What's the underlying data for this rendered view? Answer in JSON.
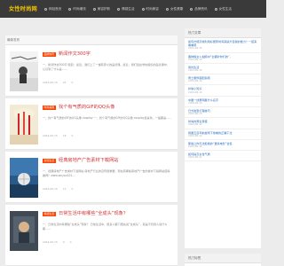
{
  "header": {
    "logo": "女性时尚网",
    "nav": [
      "网站首页",
      "时尚潮流",
      "美容护肤",
      "情感生活",
      "时尚美容",
      "女性健康",
      "品牌资讯",
      "女性生活"
    ]
  },
  "main": {
    "section_label": "最新发布",
    "posts": [
      {
        "badge": "品牌快讯",
        "title": "新闻作文300字",
        "excerpt": "一、新闻作文300字 题目：最近，我们上了一堂有意义的品德课。最近，我们班在学校组织的品德课中，认识到了什么是……",
        "date": "2024-06-15",
        "views": "24",
        "comments": "0"
      },
      {
        "badge": "时尚美容",
        "title": "找个有气质的GIF的QQ头像",
        "excerpt": "一、找个有气质的GIF的QQ头像 cosplay 一、找个有气质的GIF的QQ头像 cosplay最喜欢，一般都是……",
        "date": "2024-06-15",
        "views": "18",
        "comments": "0"
      },
      {
        "badge": "女性生活",
        "title": "经典房地产广告素材下载网站",
        "excerpt": "一、经典房地产广告素材下载网站 房地产行业的宣传很重要，现在有哪些房地产广告的素材下载网站值得推荐？www.wnyou521…",
        "date": "2024-06-15",
        "views": "12",
        "comments": "0"
      },
      {
        "badge": "情感生活",
        "title": "日常生活中有哪些“全成头”现象？",
        "excerpt": "一、日常生活中有哪些“全成头”现象？ 日常生活中，很多人都习惯先说“全成头”，就是不管别人说什么都……",
        "date": "2024-06-15",
        "views": "9",
        "comments": "0"
      }
    ]
  },
  "sidebar": {
    "hot_title": "热门文章",
    "hot": [
      {
        "title": "如何才能高效利用好居家时间来提升自我的能力？一起来看看吧",
        "date": "2024-06-15"
      },
      {
        "title": "黑种族女人拍照中“全都听你们的”，",
        "date": "2024-06-15"
      },
      {
        "title": "简约生活",
        "date": "2024-06-15"
      },
      {
        "title": "男士服饰搭配指南",
        "date": "2024-06-14"
      },
      {
        "title": "护肤小知识",
        "date": "2024-06-14"
      },
      {
        "title": "中国一线男明星什么名字",
        "date": "2024-06-13"
      },
      {
        "title": "日式发型打理技巧",
        "date": "2024-06-13"
      },
      {
        "title": "时尚的男生穿搭",
        "date": "2024-06-12"
      },
      {
        "title": "我国五百年前发明下象棋的正确下法",
        "date": "2024-06-12"
      },
      {
        "title": "那些让你无法拒绝的“爱情电影”合集",
        "date": "2024-06-11"
      },
      {
        "title": "如何提高女性气质",
        "date": "2024-06-11"
      }
    ],
    "tags_title": "热门标签"
  },
  "colors": {
    "header_bg": "#3a3a3a",
    "logo": "#f2c200",
    "badge": "#ff4400",
    "title": "#d13232",
    "link": "#2a6ebb"
  }
}
